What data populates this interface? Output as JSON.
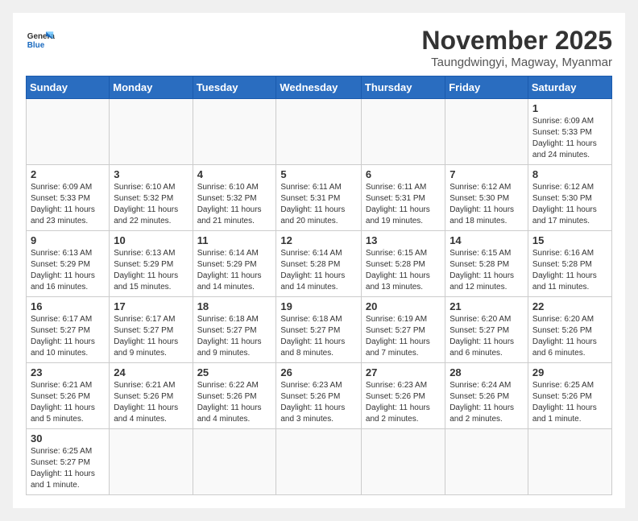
{
  "header": {
    "logo_general": "General",
    "logo_blue": "Blue",
    "month_title": "November 2025",
    "location": "Taungdwingyi, Magway, Myanmar"
  },
  "weekdays": [
    "Sunday",
    "Monday",
    "Tuesday",
    "Wednesday",
    "Thursday",
    "Friday",
    "Saturday"
  ],
  "weeks": [
    [
      {
        "day": "",
        "text": ""
      },
      {
        "day": "",
        "text": ""
      },
      {
        "day": "",
        "text": ""
      },
      {
        "day": "",
        "text": ""
      },
      {
        "day": "",
        "text": ""
      },
      {
        "day": "",
        "text": ""
      },
      {
        "day": "1",
        "text": "Sunrise: 6:09 AM\nSunset: 5:33 PM\nDaylight: 11 hours and 24 minutes."
      }
    ],
    [
      {
        "day": "2",
        "text": "Sunrise: 6:09 AM\nSunset: 5:33 PM\nDaylight: 11 hours and 23 minutes."
      },
      {
        "day": "3",
        "text": "Sunrise: 6:10 AM\nSunset: 5:32 PM\nDaylight: 11 hours and 22 minutes."
      },
      {
        "day": "4",
        "text": "Sunrise: 6:10 AM\nSunset: 5:32 PM\nDaylight: 11 hours and 21 minutes."
      },
      {
        "day": "5",
        "text": "Sunrise: 6:11 AM\nSunset: 5:31 PM\nDaylight: 11 hours and 20 minutes."
      },
      {
        "day": "6",
        "text": "Sunrise: 6:11 AM\nSunset: 5:31 PM\nDaylight: 11 hours and 19 minutes."
      },
      {
        "day": "7",
        "text": "Sunrise: 6:12 AM\nSunset: 5:30 PM\nDaylight: 11 hours and 18 minutes."
      },
      {
        "day": "8",
        "text": "Sunrise: 6:12 AM\nSunset: 5:30 PM\nDaylight: 11 hours and 17 minutes."
      }
    ],
    [
      {
        "day": "9",
        "text": "Sunrise: 6:13 AM\nSunset: 5:29 PM\nDaylight: 11 hours and 16 minutes."
      },
      {
        "day": "10",
        "text": "Sunrise: 6:13 AM\nSunset: 5:29 PM\nDaylight: 11 hours and 15 minutes."
      },
      {
        "day": "11",
        "text": "Sunrise: 6:14 AM\nSunset: 5:29 PM\nDaylight: 11 hours and 14 minutes."
      },
      {
        "day": "12",
        "text": "Sunrise: 6:14 AM\nSunset: 5:28 PM\nDaylight: 11 hours and 14 minutes."
      },
      {
        "day": "13",
        "text": "Sunrise: 6:15 AM\nSunset: 5:28 PM\nDaylight: 11 hours and 13 minutes."
      },
      {
        "day": "14",
        "text": "Sunrise: 6:15 AM\nSunset: 5:28 PM\nDaylight: 11 hours and 12 minutes."
      },
      {
        "day": "15",
        "text": "Sunrise: 6:16 AM\nSunset: 5:28 PM\nDaylight: 11 hours and 11 minutes."
      }
    ],
    [
      {
        "day": "16",
        "text": "Sunrise: 6:17 AM\nSunset: 5:27 PM\nDaylight: 11 hours and 10 minutes."
      },
      {
        "day": "17",
        "text": "Sunrise: 6:17 AM\nSunset: 5:27 PM\nDaylight: 11 hours and 9 minutes."
      },
      {
        "day": "18",
        "text": "Sunrise: 6:18 AM\nSunset: 5:27 PM\nDaylight: 11 hours and 9 minutes."
      },
      {
        "day": "19",
        "text": "Sunrise: 6:18 AM\nSunset: 5:27 PM\nDaylight: 11 hours and 8 minutes."
      },
      {
        "day": "20",
        "text": "Sunrise: 6:19 AM\nSunset: 5:27 PM\nDaylight: 11 hours and 7 minutes."
      },
      {
        "day": "21",
        "text": "Sunrise: 6:20 AM\nSunset: 5:27 PM\nDaylight: 11 hours and 6 minutes."
      },
      {
        "day": "22",
        "text": "Sunrise: 6:20 AM\nSunset: 5:26 PM\nDaylight: 11 hours and 6 minutes."
      }
    ],
    [
      {
        "day": "23",
        "text": "Sunrise: 6:21 AM\nSunset: 5:26 PM\nDaylight: 11 hours and 5 minutes."
      },
      {
        "day": "24",
        "text": "Sunrise: 6:21 AM\nSunset: 5:26 PM\nDaylight: 11 hours and 4 minutes."
      },
      {
        "day": "25",
        "text": "Sunrise: 6:22 AM\nSunset: 5:26 PM\nDaylight: 11 hours and 4 minutes."
      },
      {
        "day": "26",
        "text": "Sunrise: 6:23 AM\nSunset: 5:26 PM\nDaylight: 11 hours and 3 minutes."
      },
      {
        "day": "27",
        "text": "Sunrise: 6:23 AM\nSunset: 5:26 PM\nDaylight: 11 hours and 2 minutes."
      },
      {
        "day": "28",
        "text": "Sunrise: 6:24 AM\nSunset: 5:26 PM\nDaylight: 11 hours and 2 minutes."
      },
      {
        "day": "29",
        "text": "Sunrise: 6:25 AM\nSunset: 5:26 PM\nDaylight: 11 hours and 1 minute."
      }
    ],
    [
      {
        "day": "30",
        "text": "Sunrise: 6:25 AM\nSunset: 5:27 PM\nDaylight: 11 hours and 1 minute."
      },
      {
        "day": "",
        "text": ""
      },
      {
        "day": "",
        "text": ""
      },
      {
        "day": "",
        "text": ""
      },
      {
        "day": "",
        "text": ""
      },
      {
        "day": "",
        "text": ""
      },
      {
        "day": "",
        "text": ""
      }
    ]
  ]
}
